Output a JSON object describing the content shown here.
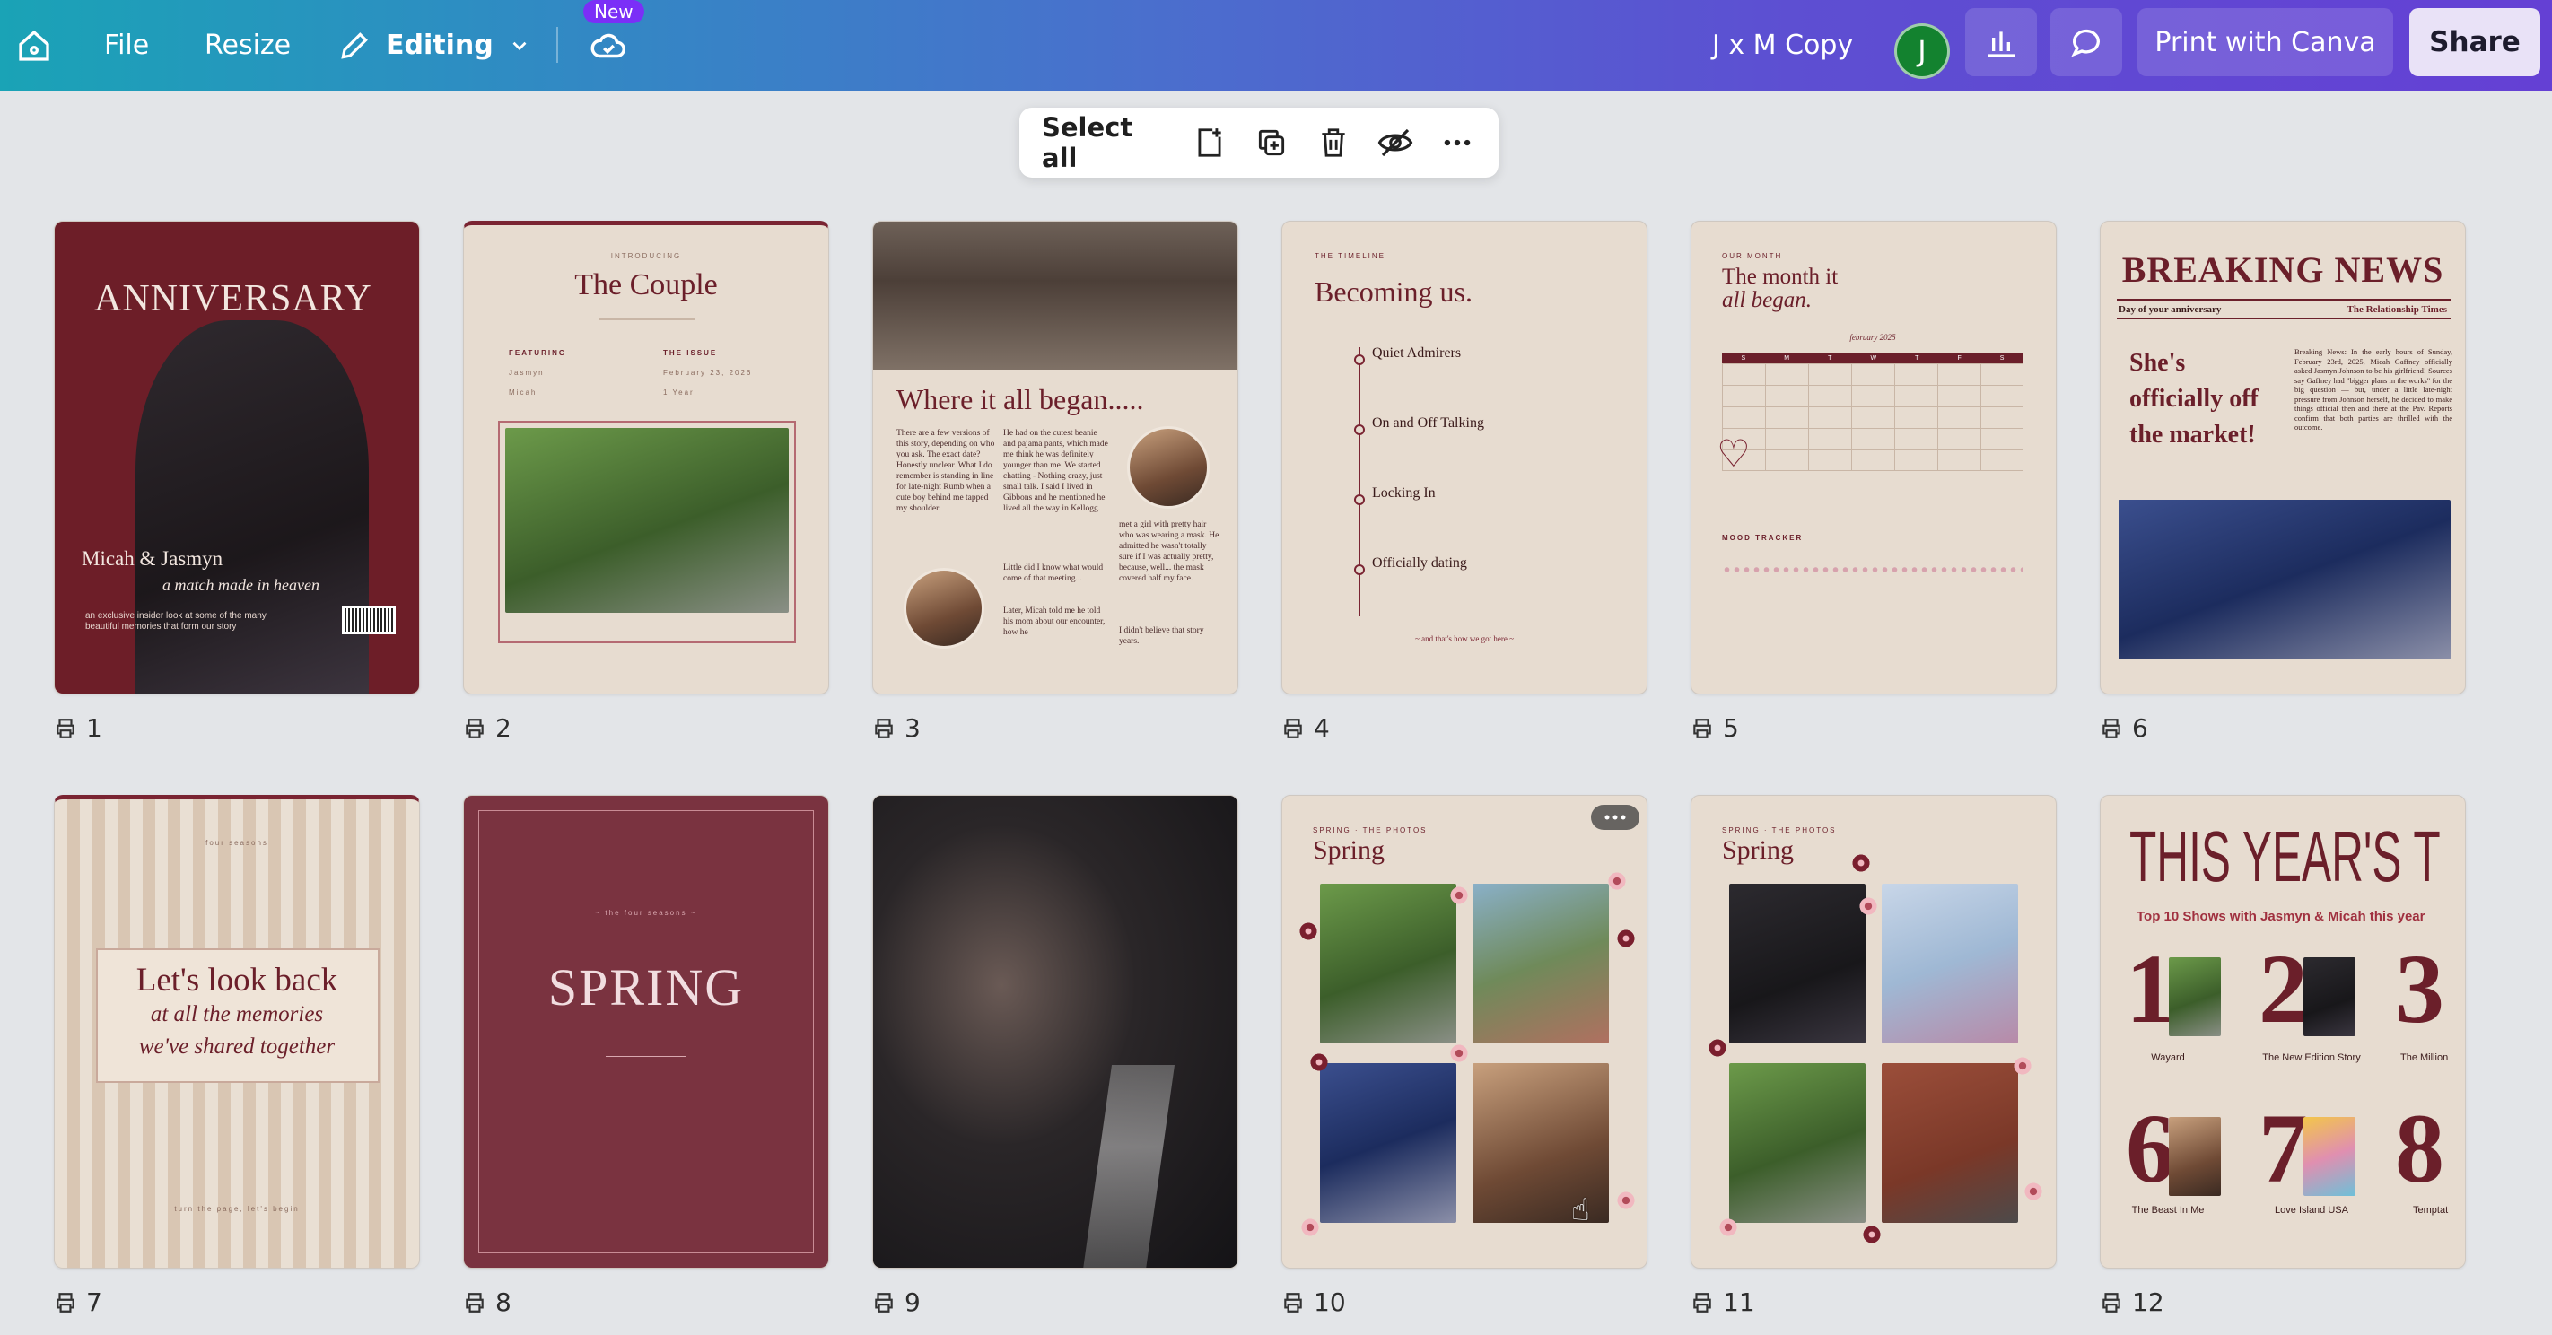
{
  "topbar": {
    "file_label": "File",
    "resize_label": "Resize",
    "editing_label": "Editing",
    "new_badge": "New",
    "design_title": "J x M Copy",
    "avatar_initial": "J",
    "print_label": "Print with Canva",
    "share_label": "Share"
  },
  "selection_bar": {
    "select_all_label": "Select all"
  },
  "pages": [
    {
      "number": "1",
      "title": "ANNIVERSARY",
      "names": "Micah & Jasmyn",
      "script": "a match made in heaven",
      "blurb": "an exclusive insider look at some of the many beautiful memories that form our story"
    },
    {
      "number": "2",
      "kicker": "INTRODUCING",
      "title": "The Couple",
      "col1_head": "FEATURING",
      "col2_head": "THE ISSUE",
      "row1_left": "Jasmyn",
      "row1_right": "February 23, 2026",
      "row2_left": "Micah",
      "row2_right": "1 Year"
    },
    {
      "number": "3",
      "title": "Where it all began.....",
      "col1": "There are a few versions of this story, depending on who you ask. The exact date? Honestly unclear. What I do remember is standing in line for late-night Rumb when a cute boy behind me tapped my shoulder.",
      "col2": "He had on the cutest beanie and pajama pants, which made me think he was definitely younger than me. We started chatting - Nothing crazy, just small talk. I said I lived in Gibbons and he mentioned he lived all the way in Kellogg.",
      "col2b": "Little did I know what would come of that meeting...",
      "col2c": "Later, Micah told me he told his mom about our encounter, how he",
      "col3": "met a girl with pretty hair who was wearing a mask. He admitted he wasn't totally sure if I was actually pretty, because, well... the mask covered half my face.",
      "col3b": "I didn't believe that story years."
    },
    {
      "number": "4",
      "kicker": "THE TIMELINE",
      "title": "Becoming us.",
      "phase1": "Quiet Admirers",
      "phase2": "On and Off Talking",
      "phase3": "Locking In",
      "phase4": "Officially dating",
      "footer": "~ and that's how we got here ~"
    },
    {
      "number": "5",
      "kicker": "OUR MONTH",
      "title_line1": "The month it",
      "title_line2": "all began.",
      "month": "february 2025",
      "days": [
        "S",
        "M",
        "T",
        "W",
        "T",
        "F",
        "S"
      ],
      "tracker": "MOOD TRACKER"
    },
    {
      "number": "6",
      "headline": "BREAKING NEWS",
      "sub_left": "Day of your anniversary",
      "sub_right": "The Relationship Times",
      "big_line1": "She's",
      "big_line2": "officially off",
      "big_line3": "the market!",
      "body": "Breaking News: In the early hours of Sunday, February 23rd, 2025, Micah Gaffney officially asked Jasmyn Johnson to be his girlfriend! Sources say Gaffney had \"bigger plans in the works\" for the big question — but, under a little late-night pressure from Johnson herself, he decided to make things official then and there at the Pav. Reports confirm that both parties are thrilled with the outcome."
    },
    {
      "number": "7",
      "kicker": "four seasons",
      "line1": "Let's look back",
      "line2": "at all the memories",
      "line3": "we've shared together",
      "footer": "turn the page, let's begin"
    },
    {
      "number": "8",
      "kicker": "~ the four seasons ~",
      "title": "SPRING"
    },
    {
      "number": "9"
    },
    {
      "number": "10",
      "kicker": "SPRING · THE PHOTOS",
      "title": "Spring"
    },
    {
      "number": "11",
      "kicker": "SPRING · THE PHOTOS",
      "title": "Spring"
    },
    {
      "number": "12",
      "title": "THIS YEAR'S T",
      "subtitle": "Top 10 Shows with Jasmyn & Micah this year",
      "shows": [
        {
          "rank": "1",
          "name": "Wayard"
        },
        {
          "rank": "2",
          "name": "The New Edition Story"
        },
        {
          "rank": "3",
          "name": "The Million"
        },
        {
          "rank": "6",
          "name": "The Beast In Me"
        },
        {
          "rank": "7",
          "name": "Love Island USA"
        },
        {
          "rank": "8",
          "name": "Temptat"
        }
      ]
    }
  ]
}
